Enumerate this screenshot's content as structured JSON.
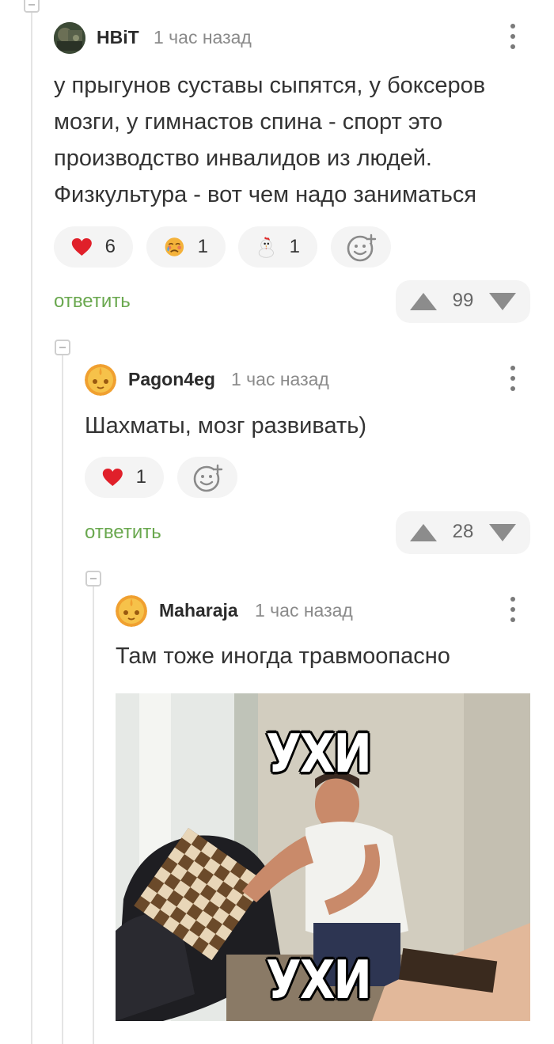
{
  "comments": [
    {
      "username": "HBiT",
      "time": "1 час назад",
      "text_lines": [
        "у прыгунов суставы сыпятся, у боксеров",
        "мозги, у гимнастов спина - спорт это",
        "производство инвалидов из людей.",
        "Физкультура - вот чем надо заниматься"
      ],
      "reactions": [
        {
          "icon": "heart-icon",
          "count": "6"
        },
        {
          "icon": "crying-face-icon",
          "count": "1"
        },
        {
          "icon": "chicken-icon",
          "count": "1"
        }
      ],
      "reply_label": "ответить",
      "rating": "99"
    },
    {
      "username": "Pagon4eg",
      "time": "1 час назад",
      "text": "Шахматы, мозг развивать)",
      "reactions": [
        {
          "icon": "heart-icon",
          "count": "1"
        }
      ],
      "reply_label": "ответить",
      "rating": "28"
    },
    {
      "username": "Maharaja",
      "time": "1 час назад",
      "text": "Там тоже иногда травмоопасно",
      "image": {
        "caption_top": "УХИ",
        "caption_bottom": "УХИ"
      }
    }
  ],
  "colors": {
    "reply_green": "#6aa84f",
    "heart_red": "#e0202a",
    "avatar_orange": "#f0a030"
  }
}
